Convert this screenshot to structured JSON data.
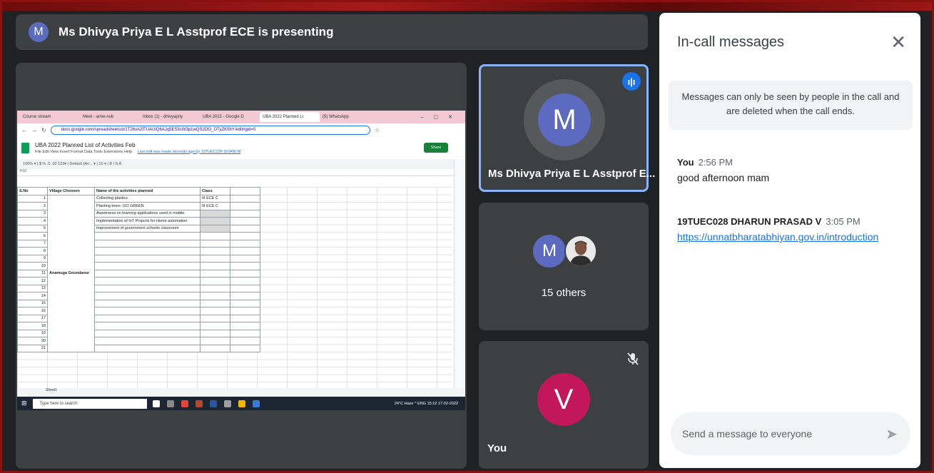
{
  "presenter": {
    "avatar_letter": "M",
    "text": "Ms Dhivya Priya E L Asstprof ECE is presenting"
  },
  "shared_screen": {
    "tabs": [
      {
        "label": "Course stream"
      },
      {
        "label": "Meet - amw-nub"
      },
      {
        "label": "Inbox (1) - dhivyapriy"
      },
      {
        "label": "UBA 2022 - Google D"
      },
      {
        "label": "UBA 2022 Planned Li"
      },
      {
        "label": "(5) WhatsApp"
      }
    ],
    "url": "docs.google.com/spreadsheets/d/1T26vA2fTUAUiQ6AJq5ES5cW3p1wQS2OO_OTyZK5hY/edit#gid=0",
    "doc_title": "UBA 2022 Planned List of Activities Feb",
    "menu": "File  Edit  View  Insert  Format  Data  Tools  Extensions  Help",
    "last_edit": "Last edit was made seconds ago by 19TUEC226 SIVANI M",
    "share_label": "Share",
    "toolbar": "100%  ▾  |  $  %  .0  .00  123▾  |  Default (Ari...  ▾  |  10  ▾  |  B  I  S  A",
    "cell_ref": "H10",
    "header": {
      "sno": "S.No",
      "village": "Village Choosen",
      "activity": "Name of the activities planned",
      "class": "Class"
    },
    "village": "Anamuga Goundanur",
    "rows": [
      {
        "n": "1",
        "activity": "Collecting plastics",
        "cls": "III ECE C"
      },
      {
        "n": "2",
        "activity": "Planting trees- GO GREEN",
        "cls": "III ECE C"
      },
      {
        "n": "3",
        "activity": "Awareness on learning applications used in mobile",
        "cls": ""
      },
      {
        "n": "4",
        "activity": "Implementation of IoT Projects for Home automation",
        "cls": ""
      },
      {
        "n": "5",
        "activity": "Improvement of government schools classroom",
        "cls": ""
      },
      {
        "n": "6",
        "activity": "",
        "cls": ""
      },
      {
        "n": "7",
        "activity": "",
        "cls": ""
      },
      {
        "n": "8",
        "activity": "",
        "cls": ""
      },
      {
        "n": "9",
        "activity": "",
        "cls": ""
      },
      {
        "n": "10",
        "activity": "",
        "cls": ""
      },
      {
        "n": "11",
        "activity": "",
        "cls": ""
      },
      {
        "n": "12",
        "activity": "",
        "cls": ""
      },
      {
        "n": "13",
        "activity": "",
        "cls": ""
      },
      {
        "n": "14",
        "activity": "",
        "cls": ""
      },
      {
        "n": "15",
        "activity": "",
        "cls": ""
      },
      {
        "n": "16",
        "activity": "",
        "cls": ""
      },
      {
        "n": "17",
        "activity": "",
        "cls": ""
      },
      {
        "n": "18",
        "activity": "",
        "cls": ""
      },
      {
        "n": "19",
        "activity": "",
        "cls": ""
      },
      {
        "n": "20",
        "activity": "",
        "cls": ""
      },
      {
        "n": "21",
        "activity": "",
        "cls": ""
      }
    ],
    "sheet_tab": "Sheet1",
    "taskbar_search": "Type here to search",
    "tray": "24°C Haze  ^  ENG  15:12  17-02-2022"
  },
  "tiles": {
    "speaker": {
      "avatar_letter": "M",
      "name": "Ms Dhivya Priya E L Asstprof E..."
    },
    "group": {
      "avatar_letter": "M",
      "label": "15 others"
    },
    "self": {
      "avatar_letter": "V",
      "name": "You"
    }
  },
  "chat": {
    "title": "In-call messages",
    "info": "Messages can only be seen by people in the call and are deleted when the call ends.",
    "messages": [
      {
        "sender": "You",
        "time": "2:56 PM",
        "text": "good afternoon mam"
      },
      {
        "sender": "19TUEC028 DHARUN PRASAD V",
        "time": "3:05 PM",
        "link": "https://unnatbharatabhiyan.gov.in/introduction"
      }
    ],
    "input_placeholder": "Send a message to everyone"
  },
  "colors": {
    "meet_bg": "#202124",
    "tile_bg": "#3c4043",
    "accent": "#1a73e8",
    "active_border": "#8ab4f8",
    "avatar_m": "#5c6bc0",
    "avatar_v": "#c2185b"
  }
}
